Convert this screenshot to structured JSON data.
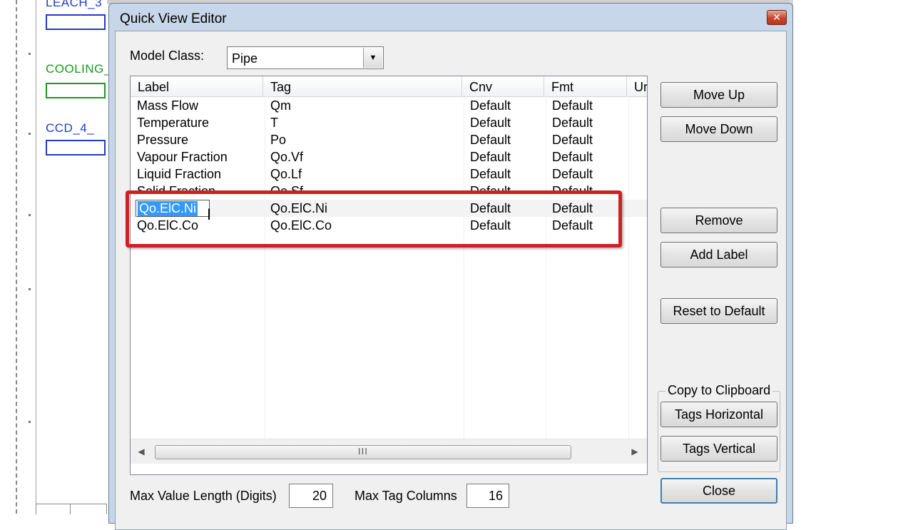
{
  "background": {
    "units": [
      {
        "label": "LEACH_3",
        "color": "#1e3cc8"
      },
      {
        "label": "COOLING_",
        "color": "#1a9a1a"
      },
      {
        "label": "CCD_4_",
        "color": "#1e3cc8"
      }
    ]
  },
  "dialog": {
    "title": "Quick View Editor",
    "close_label": "✕",
    "model_class": {
      "label": "Model Class:",
      "value": "Pipe"
    },
    "columns": [
      "Label",
      "Tag",
      "Cnv",
      "Fmt",
      "Ur"
    ],
    "rows": [
      {
        "label": "Mass Flow",
        "tag": "Qm",
        "cnv": "Default",
        "fmt": "Default"
      },
      {
        "label": "Temperature",
        "tag": "T",
        "cnv": "Default",
        "fmt": "Default"
      },
      {
        "label": "Pressure",
        "tag": "Po",
        "cnv": "Default",
        "fmt": "Default"
      },
      {
        "label": "Vapour Fraction",
        "tag": "Qo.Vf",
        "cnv": "Default",
        "fmt": "Default"
      },
      {
        "label": "Liquid Fraction",
        "tag": "Qo.Lf",
        "cnv": "Default",
        "fmt": "Default"
      },
      {
        "label": "Solid Fraction",
        "tag": "Qo.Sf",
        "cnv": "Default",
        "fmt": "Default"
      },
      {
        "label": "Qo.ElC.Ni",
        "tag": "Qo.ElC.Ni",
        "cnv": "Default",
        "fmt": "Default"
      },
      {
        "label": "Qo.ElC.Co",
        "tag": "Qo.ElC.Co",
        "cnv": "Default",
        "fmt": "Default"
      }
    ],
    "scroll_grip": "III",
    "buttons": {
      "move_up": "Move Up",
      "move_down": "Move Down",
      "remove": "Remove",
      "add_label": "Add Label",
      "reset_default": "Reset to Default",
      "clipboard_group": "Copy to Clipboard",
      "tags_horizontal": "Tags Horizontal",
      "tags_vertical": "Tags Vertical",
      "close": "Close"
    },
    "max_value_length": {
      "label": "Max Value Length (Digits)",
      "value": "20"
    },
    "max_tag_columns": {
      "label": "Max Tag Columns",
      "value": "16"
    },
    "highlight_color": "#d11f25"
  }
}
